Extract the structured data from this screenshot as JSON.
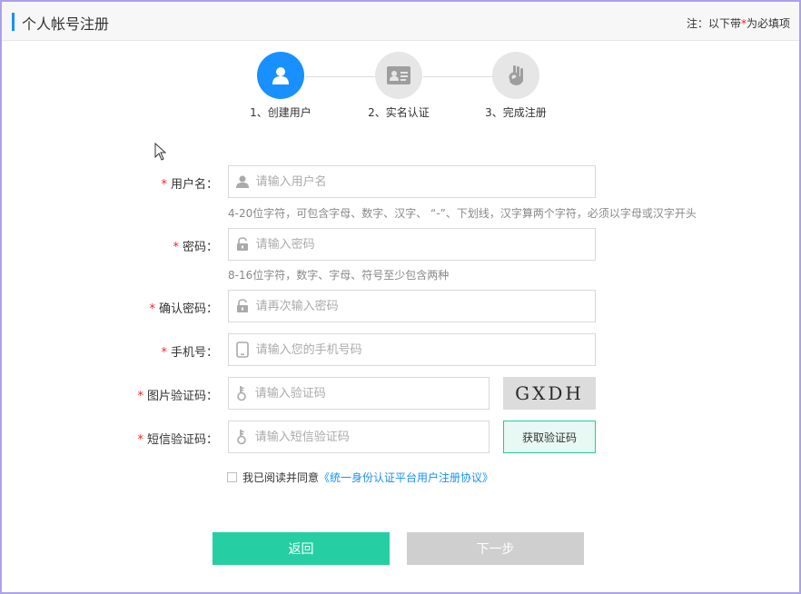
{
  "header": {
    "title": "个人帐号注册",
    "note_prefix": "注：以下带",
    "note_star": "*",
    "note_suffix": "为必填项"
  },
  "steps": [
    {
      "label": "1、创建用户",
      "icon": "user-icon",
      "active": true
    },
    {
      "label": "2、实名认证",
      "icon": "id-card-icon",
      "active": false
    },
    {
      "label": "3、完成注册",
      "icon": "ok-hand-icon",
      "active": false
    }
  ],
  "form": {
    "required_mark": "*",
    "username": {
      "label": "用户名：",
      "placeholder": "请输入用户名",
      "hint": "4-20位字符，可包含字母、数字、汉字、 “-”、下划线，汉字算两个字符，必须以字母或汉字开头"
    },
    "password": {
      "label": "密码：",
      "placeholder": "请输入密码",
      "hint": "8-16位字符，数字、字母、符号至少包含两种"
    },
    "confirm_password": {
      "label": "确认密码：",
      "placeholder": "请再次输入密码"
    },
    "phone": {
      "label": "手机号：",
      "placeholder": "请输入您的手机号码"
    },
    "image_code": {
      "label": "图片验证码：",
      "placeholder": "请输入验证码",
      "captcha_text": "GXDH"
    },
    "sms_code": {
      "label": "短信验证码：",
      "placeholder": "请输入短信验证码",
      "button": "获取验证码"
    }
  },
  "agreement": {
    "text": "我已阅读并同意",
    "link": "《统一身份认证平台用户注册协议》"
  },
  "buttons": {
    "back": "返回",
    "next": "下一步"
  },
  "colors": {
    "accent": "#1890ff",
    "primary_button": "#26cfa3",
    "disabled_button": "#cfcfcf",
    "required": "#f5222d"
  }
}
